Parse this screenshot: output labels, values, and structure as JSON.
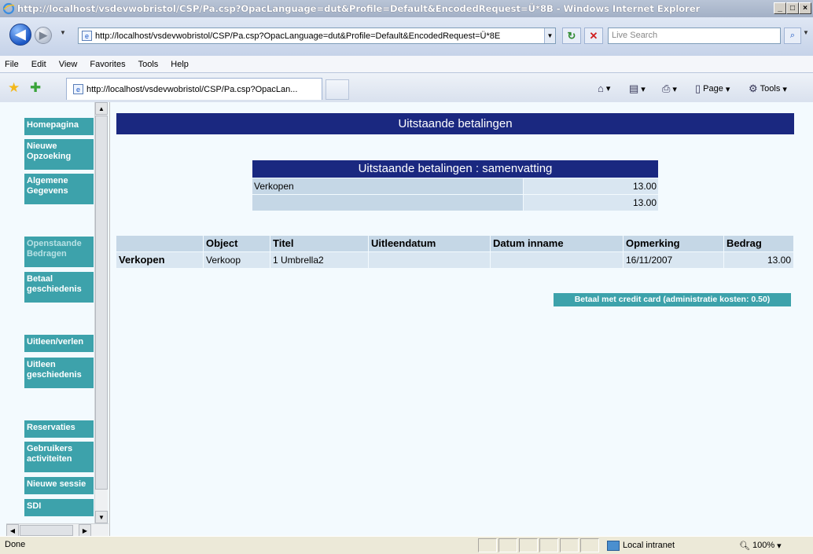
{
  "window": {
    "title": "http://localhost/vsdevwobristol/CSP/Pa.csp?OpacLanguage=dut&Profile=Default&EncodedRequest=Ü*8B - Windows Internet Explorer",
    "minimize": "_",
    "maximize": "□",
    "close": "×"
  },
  "toolbar": {
    "address": "http://localhost/vsdevwobristol/CSP/Pa.csp?OpacLanguage=dut&Profile=Default&EncodedRequest=Ü*8E",
    "search_placeholder": "Live Search"
  },
  "menu": [
    "File",
    "Edit",
    "View",
    "Favorites",
    "Tools",
    "Help"
  ],
  "tab": {
    "title": "http://localhost/vsdevwobristol/CSP/Pa.csp?OpacLan..."
  },
  "commands": {
    "page": "Page",
    "tools": "Tools"
  },
  "sidebar": {
    "items": [
      {
        "label": "Homepagina",
        "enabled": true
      },
      {
        "label": "Nieuwe\nOpzoeking",
        "enabled": true
      },
      {
        "label": "Algemene\nGegevens",
        "enabled": true
      },
      {
        "label": "Openstaande\nBedragen",
        "enabled": false
      },
      {
        "label": "Betaal\ngeschiedenis",
        "enabled": true
      },
      {
        "label": "Uitleen/verlen",
        "enabled": true
      },
      {
        "label": "Uitleen\ngeschiedenis",
        "enabled": true
      },
      {
        "label": "Reservaties",
        "enabled": true
      },
      {
        "label": "Gebruikers\nactiviteiten",
        "enabled": true
      },
      {
        "label": "Nieuwe sessie",
        "enabled": true
      },
      {
        "label": "SDI",
        "enabled": true
      }
    ]
  },
  "main": {
    "heading": "Uitstaande betalingen",
    "summary": {
      "heading": "Uitstaande betalingen : samenvatting",
      "rows": [
        {
          "label": "Verkopen",
          "value": "13.00"
        },
        {
          "label": "",
          "value": "13.00"
        }
      ]
    },
    "detail": {
      "columns": [
        "",
        "Object",
        "Titel",
        "Uitleendatum",
        "Datum inname",
        "Opmerking",
        "Bedrag"
      ],
      "rows": [
        [
          "Verkopen",
          "Verkoop",
          "1 Umbrella2",
          "",
          "",
          "16/11/2007",
          "13.00"
        ]
      ]
    },
    "pay_button": "Betaal met credit card (administratie kosten: 0.50)"
  },
  "status": {
    "text": "Done",
    "zone": "Local intranet",
    "zoom": "100%"
  },
  "colors": {
    "header_blue": "#1a2880",
    "button_teal": "#3da2ab",
    "page_bg": "#f3fafe"
  }
}
